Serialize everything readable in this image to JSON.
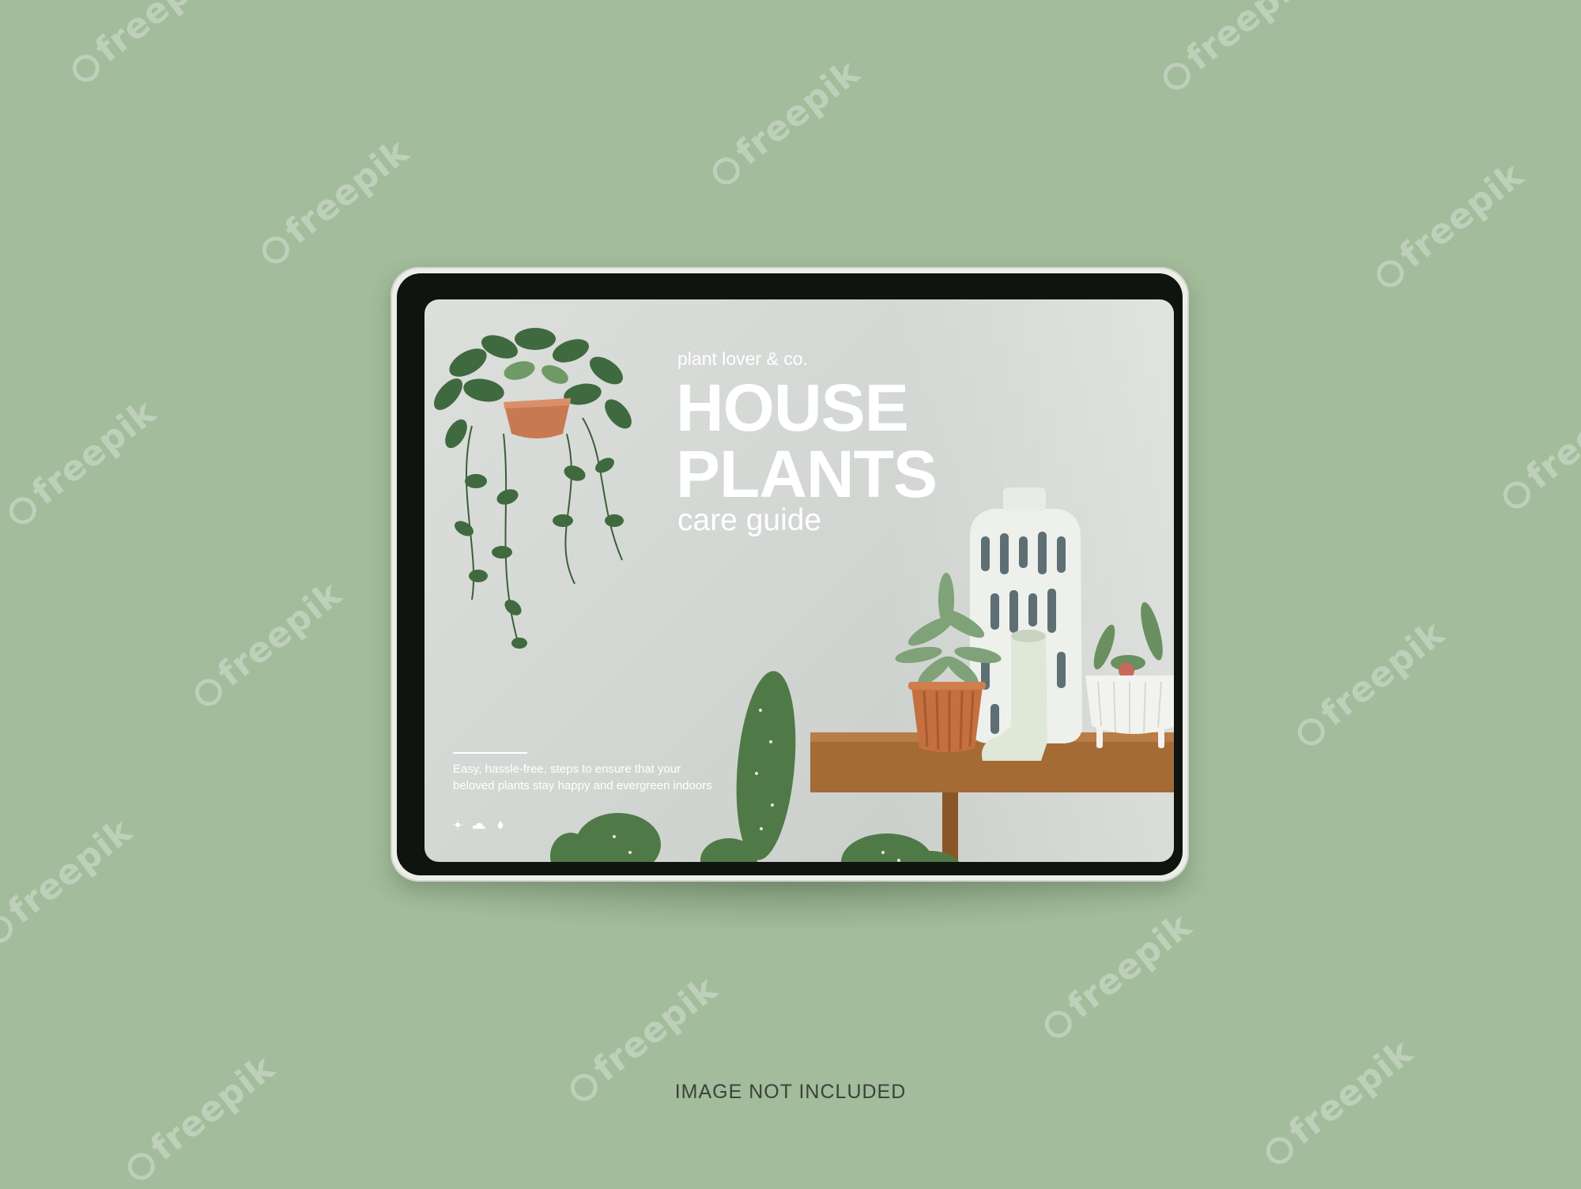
{
  "screen": {
    "brand": "plant lover & co.",
    "title_line1": "HOUSE",
    "title_line2": "PLANTS",
    "subtitle": "care guide",
    "description": "Easy, hassle-free, steps to ensure that your beloved plants stay happy and evergreen indoors",
    "icons": [
      "sun-icon",
      "cloud-icon",
      "water-drop-icon"
    ]
  },
  "caption": "IMAGE NOT INCLUDED",
  "watermark": "freepik",
  "colors": {
    "background": "#a3bc9b",
    "device_frame": "#eceee8",
    "bezel": "#101411",
    "screen_wall": "#d6d9d6",
    "text_on_screen": "#ffffff",
    "leaf_green": "#3f6a3f",
    "terracotta": "#c77a52",
    "wood": "#a56b35"
  }
}
